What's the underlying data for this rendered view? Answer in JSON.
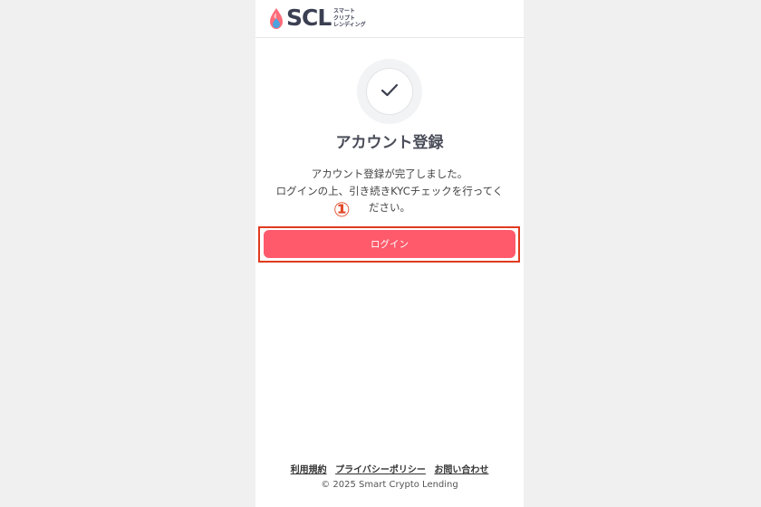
{
  "header": {
    "logo_text": "SCL",
    "logo_sub": [
      "スマート",
      "クリプト",
      "レンディング"
    ]
  },
  "main": {
    "title": "アカウント登録",
    "message_lines": [
      "アカウント登録が完了しました。",
      "ログインの上、引き続きKYCチェックを行ってく",
      "ださい。"
    ],
    "login_label": "ログイン"
  },
  "annotation": {
    "number": "①",
    "color": "#e03a1e"
  },
  "footer": {
    "links": [
      "利用規約",
      "プライバシーポリシー",
      "お問い合わせ"
    ],
    "copyright": "© 2025 Smart Crypto Lending"
  },
  "colors": {
    "accent": "#ff5a6b",
    "text": "#4a4d59"
  }
}
